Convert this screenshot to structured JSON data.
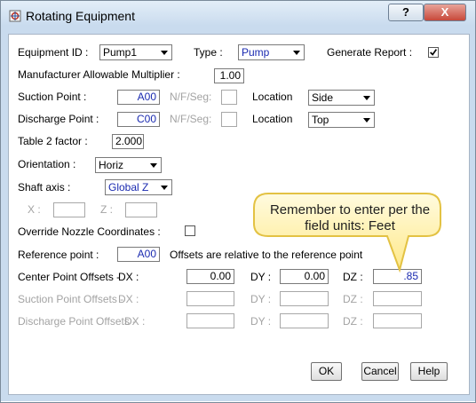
{
  "window": {
    "title": "Rotating Equipment",
    "help_glyph": "?",
    "close_glyph": "X"
  },
  "form": {
    "equipment_id_label": "Equipment ID :",
    "equipment_id_value": "Pump1",
    "type_label": "Type :",
    "type_value": "Pump",
    "generate_report_label": "Generate Report :",
    "generate_report_checked": true,
    "multiplier_label": "Manufacturer Allowable Multiplier :",
    "multiplier_value": "1.00",
    "suction_point_label": "Suction Point :",
    "suction_point_value": "A00",
    "nfseg_label": "N/F/Seg:",
    "location_label": "Location",
    "suction_location_value": "Side",
    "discharge_point_label": "Discharge Point :",
    "discharge_point_value": "C00",
    "discharge_location_value": "Top",
    "table2_label": "Table 2 factor :",
    "table2_value": "2.000",
    "orientation_label": "Orientation :",
    "orientation_value": "Horiz",
    "shaft_axis_label": "Shaft axis :",
    "shaft_axis_value": "Global Z",
    "x_label": "X :",
    "z_label": "Z :",
    "override_label": "Override Nozzle Coordinates :",
    "override_checked": false,
    "reference_point_label": "Reference point :",
    "reference_point_value": "A00",
    "offsets_note": "Offsets are relative to the reference point",
    "center_label": "Center Point Offsets -",
    "suction_offsets_label": "Suction Point Offsets -",
    "discharge_offsets_label": "Discharge Point Offsets -",
    "dx_label": "DX :",
    "dy_label": "DY :",
    "dz_label": "DZ :",
    "center_dx": "0.00",
    "center_dy": "0.00",
    "center_dz": ".85"
  },
  "callout": {
    "text": "Remember to enter per the field units: Feet"
  },
  "buttons": {
    "ok": "OK",
    "cancel": "Cancel",
    "help": "Help"
  },
  "colors": {
    "value_blue": "#1a2ab0",
    "callout_fill": "#fff4b8",
    "callout_border": "#e8c84a"
  }
}
